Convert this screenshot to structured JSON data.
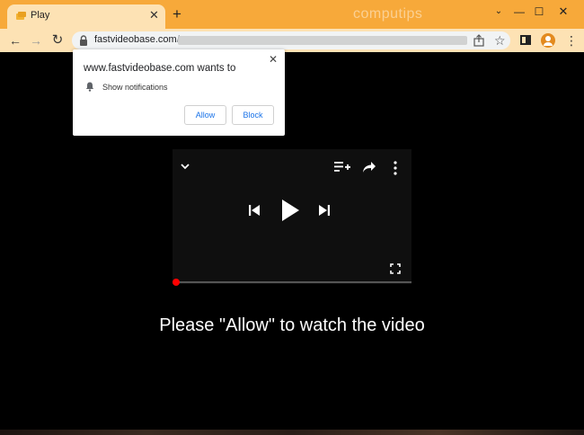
{
  "browser": {
    "tab": {
      "title": "Play"
    },
    "watermark": "computips",
    "url": {
      "host": "fastvideobase.com",
      "path": "/"
    }
  },
  "notification_prompt": {
    "title": "www.fastvideobase.com wants to",
    "permission": "Show notifications",
    "allow_label": "Allow",
    "block_label": "Block"
  },
  "player": {
    "progress_fraction": 0.0
  },
  "page": {
    "caption": "Please \"Allow\" to watch the video"
  },
  "colors": {
    "titlebar": "#f7a93a",
    "toolbar": "#fde2b4",
    "accent_link": "#1a73e8",
    "progress": "#ff0000"
  },
  "icons": {
    "tab": [
      "favicon-icon",
      "close-icon",
      "plus-icon"
    ],
    "window": [
      "chevron-down-icon",
      "minimize-icon",
      "maximize-icon",
      "close-icon"
    ],
    "toolbar": [
      "back-arrow-icon",
      "forward-arrow-icon",
      "reload-icon",
      "lock-icon",
      "share-icon",
      "star-icon",
      "side-panel-icon",
      "profile-icon",
      "menu-icon"
    ],
    "player": [
      "chevron-down-icon",
      "add-to-queue-icon",
      "share-icon",
      "more-vert-icon",
      "skip-previous-icon",
      "play-icon",
      "skip-next-icon",
      "fullscreen-icon"
    ]
  }
}
